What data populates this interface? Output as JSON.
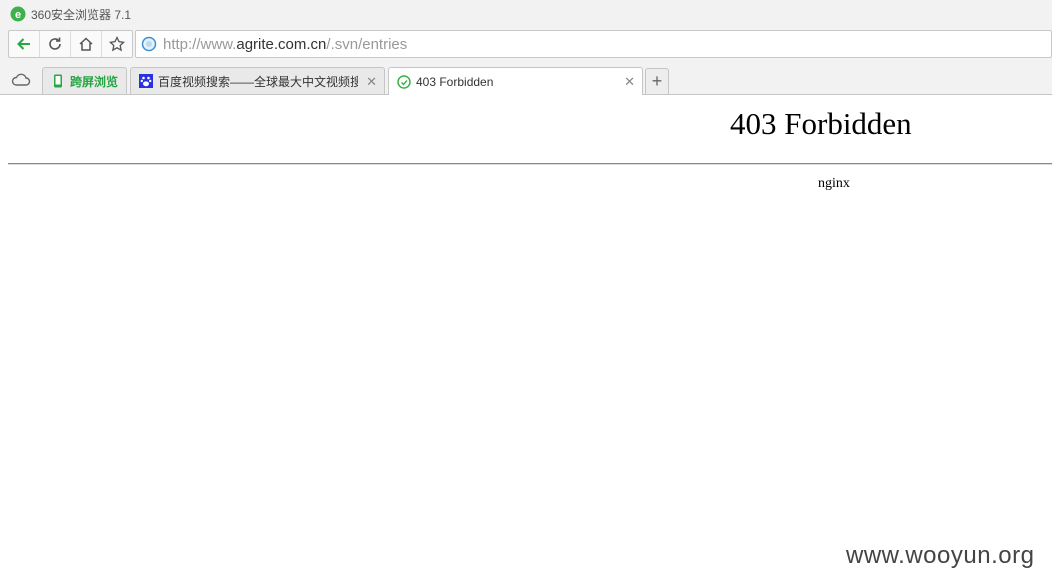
{
  "app": {
    "title": "360安全浏览器 7.1"
  },
  "address_bar": {
    "url_prefix": "http://www.",
    "url_host": "agrite.com.cn",
    "url_path": "/.svn/entries"
  },
  "tabs": [
    {
      "label": "跨屏浏览",
      "active": false
    },
    {
      "label": "百度视频搜索——全球最大中文视频搜",
      "active": false
    },
    {
      "label": "403 Forbidden",
      "active": true
    }
  ],
  "page": {
    "heading": "403 Forbidden",
    "server": "nginx"
  },
  "watermark": "www.wooyun.org",
  "colors": {
    "accent_green": "#27a644",
    "baidu_blue": "#2932e1"
  }
}
